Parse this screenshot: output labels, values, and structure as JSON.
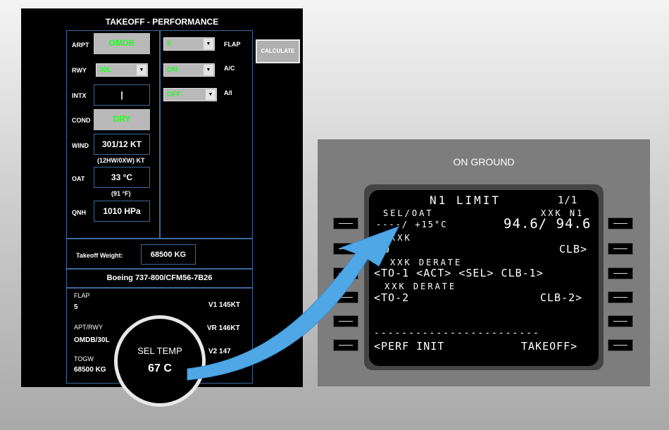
{
  "takeoff_panel": {
    "title": "TAKEOFF - PERFORMANCE",
    "arpt_label": "ARPT",
    "arpt_value": "OMDB",
    "rwy_label": "RWY",
    "rwy_value": "30L",
    "intx_label": "INTX",
    "intx_value": "|",
    "cond_label": "COND",
    "cond_value": "DRY",
    "wind_label": "WIND",
    "wind_value": "301/12 KT",
    "wind_sub": "(12HW/0XW) KT",
    "oat_label": "OAT",
    "oat_value": "33 °C",
    "oat_sub": "(91 °F)",
    "qnh_label": "QNH",
    "qnh_value": "1010 HPa",
    "flap_label": "FLAP",
    "flap_value": "5",
    "ac_label": "A/C",
    "ac_value": "ON",
    "ai_label": "A/I",
    "ai_value": "OFF",
    "calculate_label": "CALCULATE",
    "weight_label": "Takeoff Weight:",
    "weight_value": "68500 KG",
    "aircraft": "Boeing 737-800/CFM56-7B26",
    "results": {
      "flap_label": "FLAP",
      "flap_value": "5",
      "aptrwy_label": "APT/RWY",
      "aptrwy_value": "OMDB/30L",
      "togw_label": "TOGW",
      "togw_value": "68500 KG",
      "v1": "V1 145KT",
      "vr": "VR 146KT",
      "v2": "V2 147"
    }
  },
  "magnifier": {
    "label": "SEL TEMP",
    "value": "67 C"
  },
  "cdu": {
    "header": "ON GROUND",
    "lines": {
      "title": "N1 LIMIT",
      "page": "1/1",
      "l1_small": "SEL/OAT",
      "r1_small": "XXK N1",
      "l1": "----/ +15°C",
      "r1": "94.6/ 94.6",
      "l2_small": "XXK",
      "l2": "TO",
      "r2": "CLB>",
      "l3_small": "XXK DERATE",
      "l3": "<TO-1 <ACT> <SEL> CLB-1>",
      "l4_small": "XXK DERATE",
      "l4": "<TO-2",
      "r4": "CLB-2>",
      "dash": "------------------------",
      "l6": "<PERF INIT",
      "r6": "TAKEOFF>"
    }
  },
  "colors": {
    "accent_blue": "#4fa7e6",
    "field_green": "#22ff22",
    "panel_border": "#3b6a9c"
  }
}
